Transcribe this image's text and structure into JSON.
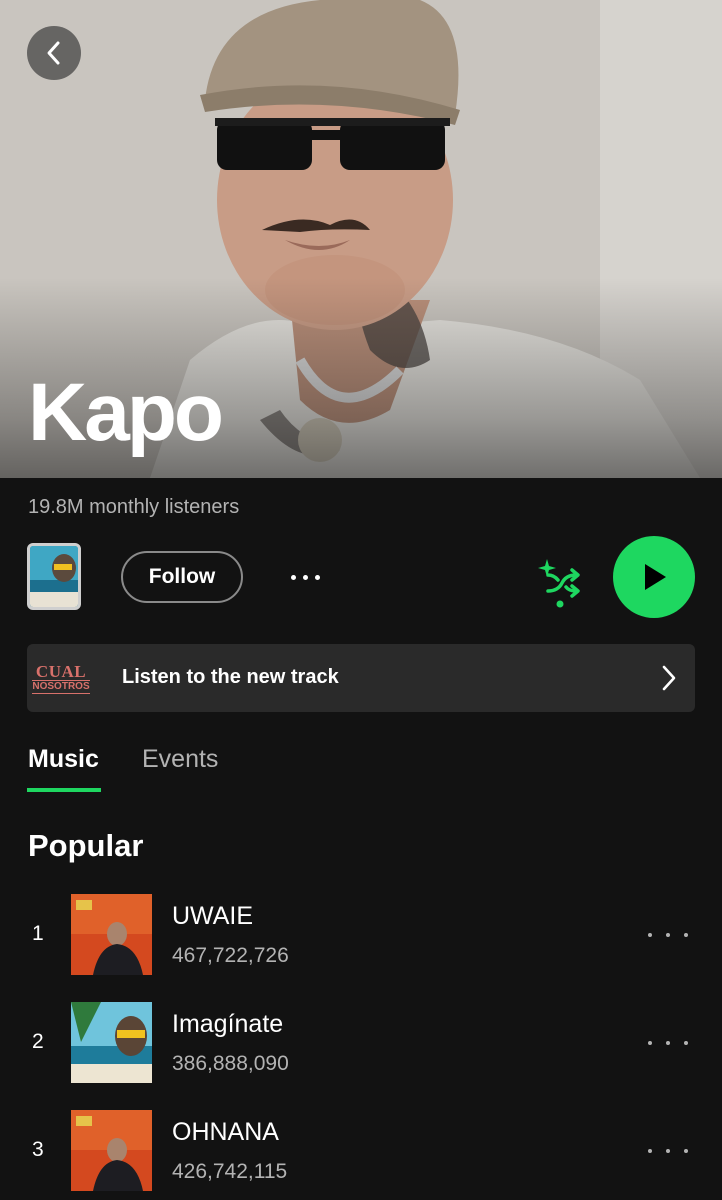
{
  "artist": {
    "name": "Kapo",
    "monthly_listeners": "19.8M monthly listeners"
  },
  "actions": {
    "follow_label": "Follow"
  },
  "banner": {
    "label": "Listen to the new track",
    "art_text_top": "CUAL",
    "art_text_bottom": "NOSOTROS"
  },
  "tabs": [
    {
      "label": "Music",
      "active": true
    },
    {
      "label": "Events",
      "active": false
    }
  ],
  "popular": {
    "title": "Popular",
    "tracks": [
      {
        "rank": "1",
        "title": "UWAIE",
        "plays": "467,722,726",
        "art": "red-cover"
      },
      {
        "rank": "2",
        "title": "Imagínate",
        "plays": "386,888,090",
        "art": "beach-cover"
      },
      {
        "rank": "3",
        "title": "OHNANA",
        "plays": "426,742,115",
        "art": "red-cover"
      }
    ]
  },
  "colors": {
    "accent": "#1ed760",
    "background": "#121212",
    "secondary_text": "#b3b3b3",
    "banner_bg": "#2a2a2a"
  },
  "icons": [
    "chevron-left-icon",
    "more-icon",
    "smart-shuffle-icon",
    "play-icon",
    "chevron-right-icon"
  ]
}
